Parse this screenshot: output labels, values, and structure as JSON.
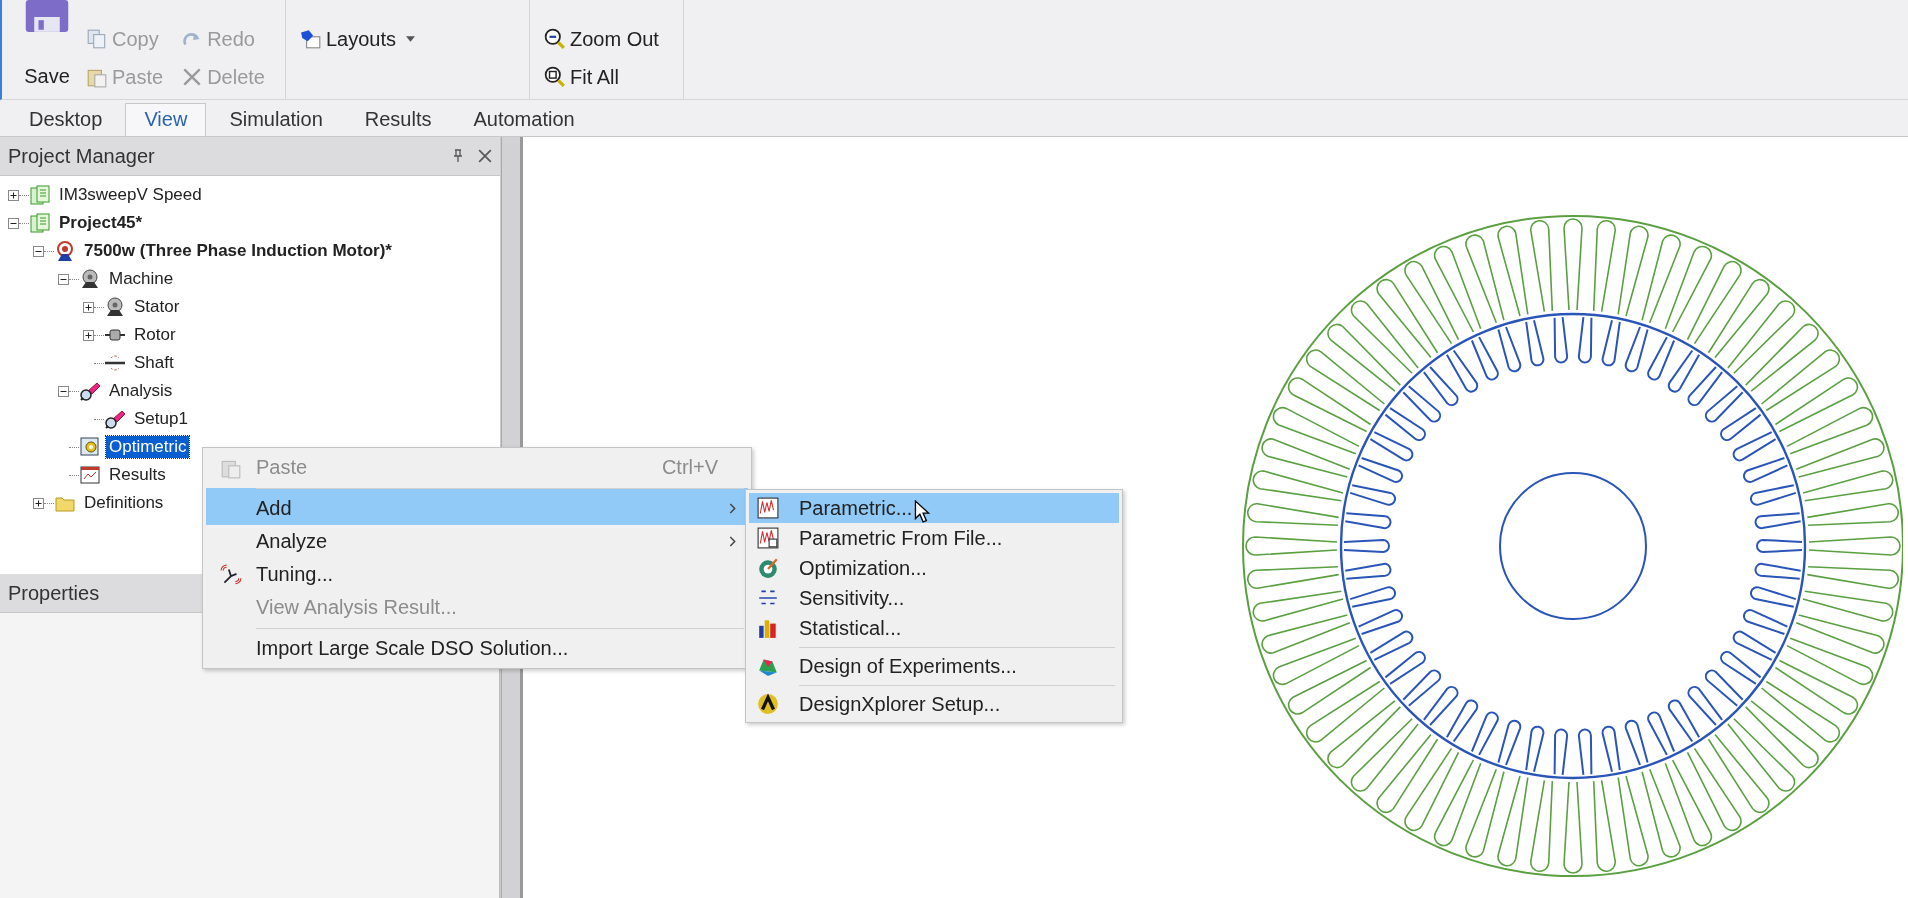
{
  "ribbon": {
    "groups": [
      {
        "buttons": [
          {
            "label": "Save",
            "kind": "large",
            "disabled": false
          },
          {
            "label": "Copy",
            "kind": "small",
            "disabled": true
          },
          {
            "label": "Paste",
            "kind": "small",
            "disabled": true
          },
          {
            "label": "Redo",
            "kind": "small",
            "disabled": true
          },
          {
            "label": "Delete",
            "kind": "small",
            "disabled": true
          }
        ]
      },
      {
        "buttons": [
          {
            "label": "Layouts",
            "kind": "dropdown",
            "disabled": false
          }
        ]
      },
      {
        "buttons": [
          {
            "label": "Zoom Out",
            "kind": "small",
            "disabled": false
          },
          {
            "label": "Fit All",
            "kind": "small",
            "disabled": false
          }
        ]
      }
    ]
  },
  "tabs": [
    {
      "label": "Desktop",
      "selected": false
    },
    {
      "label": "View",
      "selected": true
    },
    {
      "label": "Simulation",
      "selected": false
    },
    {
      "label": "Results",
      "selected": false
    },
    {
      "label": "Automation",
      "selected": false
    }
  ],
  "project_manager": {
    "title": "Project Manager",
    "tree": [
      {
        "label": "IM3sweepV Speed",
        "bold": false,
        "selected": false,
        "expanded": false
      },
      {
        "label": "Project45*",
        "bold": true,
        "selected": false,
        "expanded": true,
        "children": [
          {
            "label": "7500w (Three Phase Induction Motor)*",
            "bold": true,
            "selected": false,
            "expanded": true,
            "children": [
              {
                "label": "Machine",
                "bold": false,
                "selected": false,
                "expanded": true,
                "children": [
                  {
                    "label": "Stator",
                    "bold": false,
                    "selected": false,
                    "expanded": false
                  },
                  {
                    "label": "Rotor",
                    "bold": false,
                    "selected": false,
                    "expanded": false
                  },
                  {
                    "label": "Shaft",
                    "bold": false,
                    "selected": false
                  }
                ]
              },
              {
                "label": "Analysis",
                "bold": false,
                "selected": false,
                "expanded": true,
                "children": [
                  {
                    "label": "Setup1",
                    "bold": false,
                    "selected": false
                  }
                ]
              },
              {
                "label": "Optimetric",
                "bold": false,
                "selected": true
              },
              {
                "label": "Results",
                "bold": false,
                "selected": false
              }
            ]
          },
          {
            "label": "Definitions",
            "bold": false,
            "selected": false,
            "expanded": false
          }
        ]
      }
    ]
  },
  "properties": {
    "title": "Properties"
  },
  "context_menu": {
    "items": [
      {
        "label": "Paste",
        "shortcut": "Ctrl+V",
        "disabled": true,
        "selected": false,
        "has_submenu": false,
        "separator_before": false
      },
      {
        "label": "Add",
        "disabled": false,
        "selected": true,
        "has_submenu": true,
        "separator_before": true
      },
      {
        "label": "Analyze",
        "disabled": false,
        "selected": false,
        "has_submenu": true,
        "separator_before": false
      },
      {
        "label": "Tuning...",
        "disabled": false,
        "selected": false,
        "has_submenu": false,
        "separator_before": false
      },
      {
        "label": "View Analysis Result...",
        "disabled": true,
        "selected": false,
        "has_submenu": false,
        "separator_before": false
      },
      {
        "label": "Import Large Scale DSO Solution...",
        "disabled": false,
        "selected": false,
        "has_submenu": false,
        "separator_before": true
      }
    ]
  },
  "submenu": {
    "items": [
      {
        "label": "Parametric...",
        "selected": true,
        "separator_before": false
      },
      {
        "label": "Parametric From File...",
        "selected": false,
        "separator_before": false
      },
      {
        "label": "Optimization...",
        "selected": false,
        "separator_before": false
      },
      {
        "label": "Sensitivity...",
        "selected": false,
        "separator_before": false
      },
      {
        "label": "Statistical...",
        "selected": false,
        "separator_before": false
      },
      {
        "label": "Design of Experiments...",
        "selected": false,
        "separator_before": true
      },
      {
        "label": "DesignXplorer Setup...",
        "selected": false,
        "separator_before": true
      }
    ]
  }
}
